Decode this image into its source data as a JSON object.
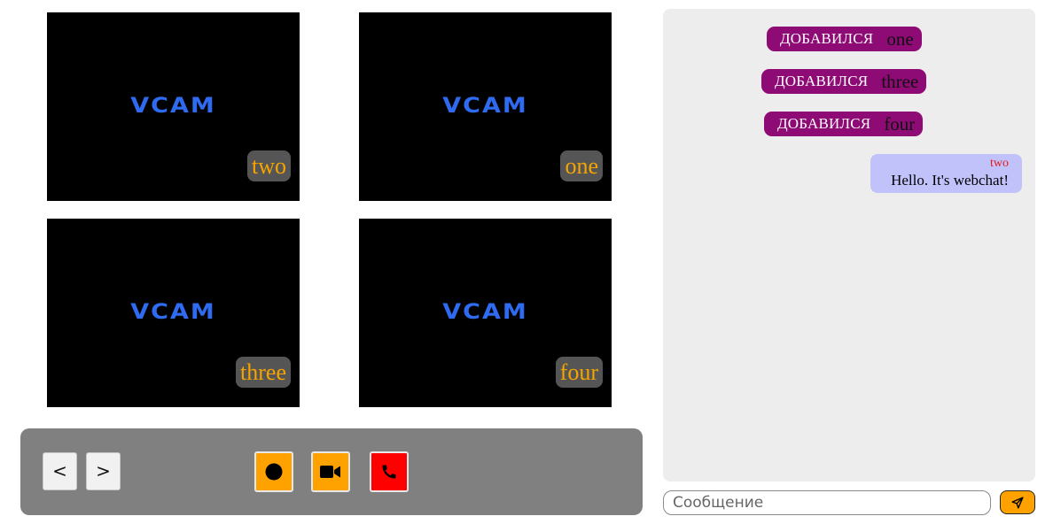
{
  "video_grid": {
    "tiles": [
      {
        "placeholder_text": "VCAM",
        "user_name": "two"
      },
      {
        "placeholder_text": "VCAM",
        "user_name": "one"
      },
      {
        "placeholder_text": "VCAM",
        "user_name": "three"
      },
      {
        "placeholder_text": "VCAM",
        "user_name": "four"
      }
    ]
  },
  "controls": {
    "prev_label": "<",
    "next_label": ">",
    "record_icon": "record-dot-icon",
    "camera_icon": "video-camera-icon",
    "hangup_icon": "phone-icon",
    "accent_color": "#ffa200",
    "hangup_color": "#ff0000"
  },
  "chat": {
    "events": [
      {
        "label": "ДОБАВИЛСЯ",
        "user": "one"
      },
      {
        "label": "ДОБАВИЛСЯ",
        "user": "three"
      },
      {
        "label": "ДОБАВИЛСЯ",
        "user": "four"
      }
    ],
    "messages": [
      {
        "author": "two",
        "text": "Hello. It's webchat!"
      }
    ],
    "input_value": "",
    "input_placeholder": "Сообщение",
    "send_icon": "paper-plane-icon",
    "event_color": "#8e0a75",
    "bubble_color": "#c2c2fb"
  }
}
